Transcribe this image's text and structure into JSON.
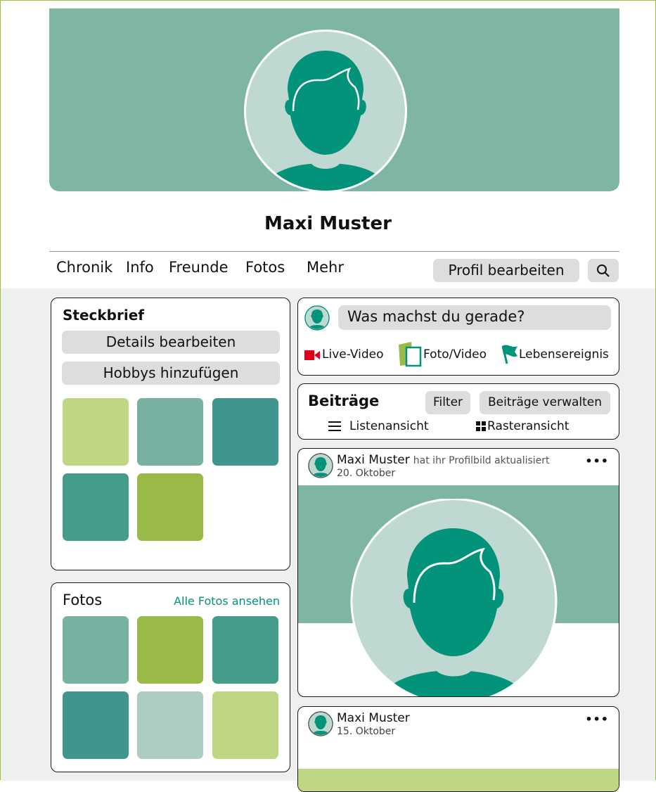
{
  "profile": {
    "name": "Maxi Muster"
  },
  "nav": {
    "tabs": [
      "Chronik",
      "Info",
      "Freunde",
      "Fotos",
      "Mehr"
    ],
    "edit_profile": "Profil bearbeiten",
    "search_icon": "search-icon"
  },
  "steckbrief": {
    "title": "Steckbrief",
    "details_button": "Details bearbeiten",
    "hobbies_button": "Hobbys hinzufügen",
    "tiles": [
      "#bfd683",
      "#78b0a1",
      "#40958d",
      "#449c8b",
      "#9aba48"
    ]
  },
  "fotos": {
    "title": "Fotos",
    "see_all": "Alle Fotos ansehen",
    "tiles": [
      "#78b0a1",
      "#9aba48",
      "#449c8b",
      "#40958d",
      "#acccc4",
      "#bfd683"
    ]
  },
  "composer": {
    "placeholder": "Was machst du gerade?",
    "actions": [
      "Live-Video",
      "Foto/Video",
      "Lebensereignis"
    ]
  },
  "posts_header": {
    "title": "Beiträge",
    "filter": "Filter",
    "manage": "Beiträge verwalten",
    "list_view": "Listenansicht",
    "grid_view": "Rasteransicht"
  },
  "posts": [
    {
      "author": "Maxi Muster",
      "action": "hat ihr Profilbild aktualisiert",
      "date": "20. Oktober",
      "more": "•••"
    },
    {
      "author": "Maxi Muster",
      "action": "",
      "date": "15. Oktober",
      "more": "•••"
    }
  ],
  "colors": {
    "accent": "#02937a",
    "cover": "#7fb5a4",
    "avatar_bg": "#bfd8d2",
    "live_red": "#e0001a",
    "photo_green": "#9aba48"
  }
}
